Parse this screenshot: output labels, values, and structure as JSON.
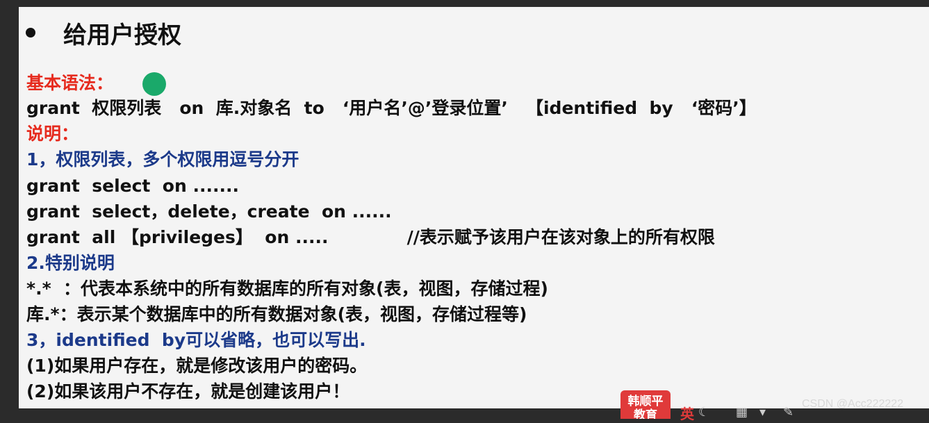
{
  "slide": {
    "title": "给用户授权",
    "lines": [
      "基本语法：",
      "grant  权限列表   on  库.对象名  to   ‘用户名’@’登录位置’   【identified  by   ‘密码’】",
      "说明：",
      "1，权限列表，多个权限用逗号分开",
      "grant  select  on .......",
      "grant  select，delete，create  on ......",
      "grant  all 【privileges】  on .....             //表示赋予该用户在该对象上的所有权限",
      "2.特别说明",
      "*.*  ：代表本系统中的所有数据库的所有对象(表，视图，存储过程)",
      "库.*：表示某个数据库中的所有数据对象(表，视图，存储过程等)",
      "3，identified  by可以省略，也可以写出.",
      "(1)如果用户存在，就是修改该用户的密码。",
      "(2)如果该用户不存在，就是创建该用户！"
    ]
  },
  "taskbar": {
    "badge_text": "韩顺平 教育",
    "ime_label": "英",
    "watermark": "CSDN @Acc222222"
  },
  "colors": {
    "red": "#e62b1e",
    "blue": "#1c3a8a",
    "black": "#111111",
    "cursor": "#1aa96a"
  },
  "icons": [
    "moon-icon",
    "keyboard-icon",
    "shirt-icon",
    "wrench-icon"
  ]
}
